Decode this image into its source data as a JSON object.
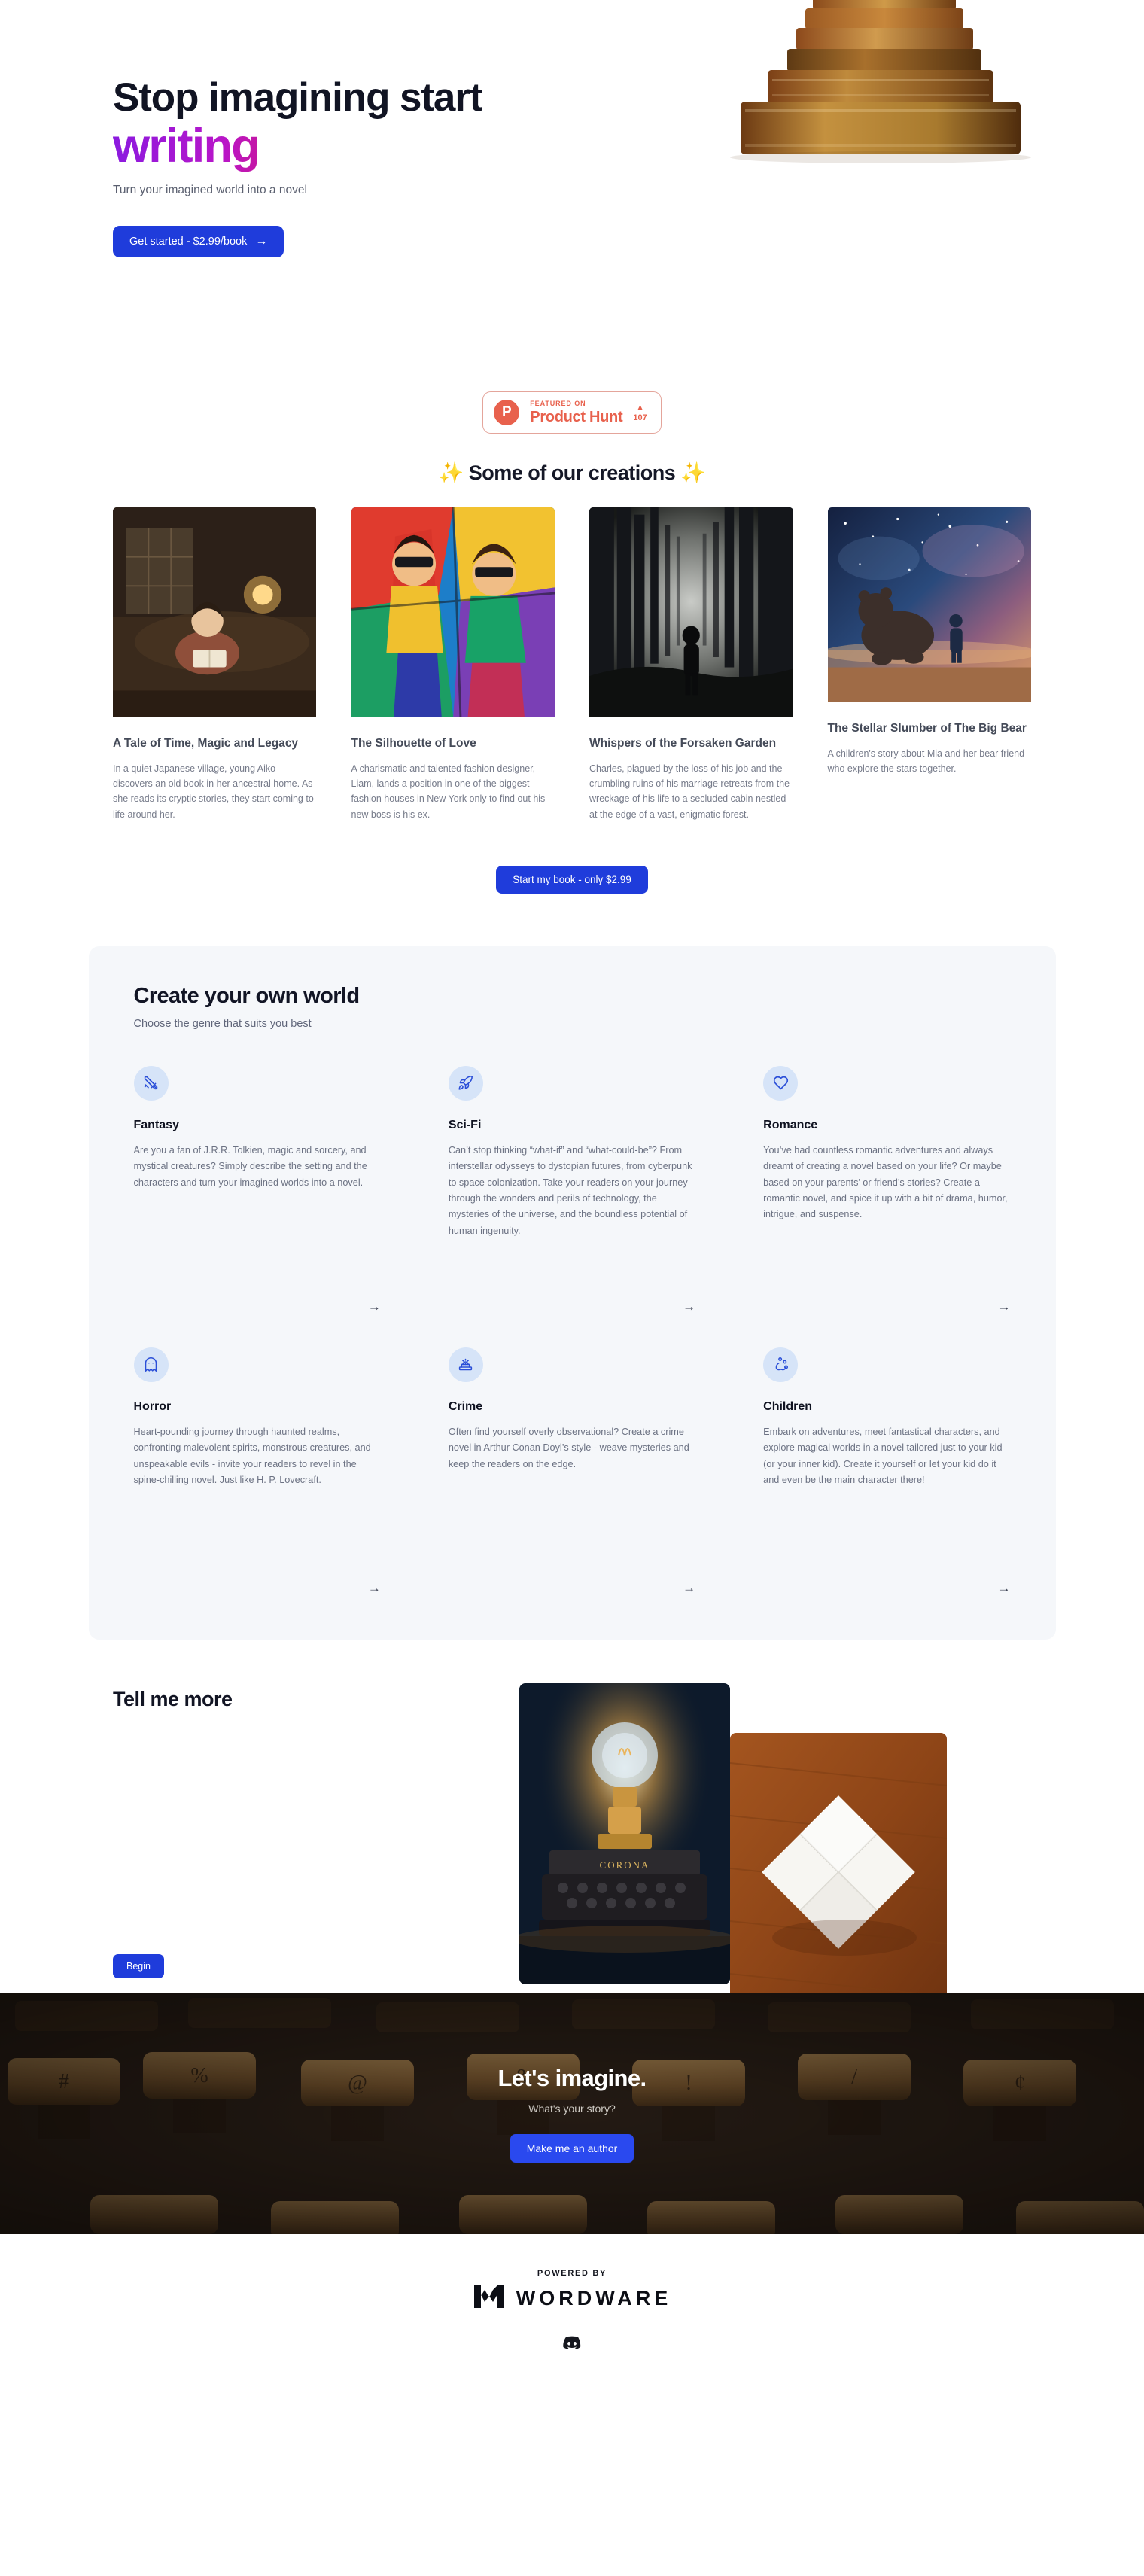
{
  "hero": {
    "title_line1": "Stop imagining start",
    "title_line2": "writing",
    "subtitle": "Turn your imagined world into a novel",
    "cta_label": "Get started - $2.99/book",
    "cta_arrow": "→",
    "books_alt": "stack-of-antique-books"
  },
  "product_hunt": {
    "logo_letter": "P",
    "kicker": "FEATURED ON",
    "name": "Product Hunt",
    "triangle": "▲",
    "votes": "107"
  },
  "creations": {
    "heading": "✨ Some of our creations ✨",
    "cta_label": "Start my book - only $2.99",
    "cards": [
      {
        "title": "A Tale of Time, Magic and Legacy",
        "desc": "In a quiet Japanese village, young Aiko discovers an old book in her ancestral home. As she reads its cryptic stories, they start coming to life around her.",
        "image_alt": "japanese-girl-reading-book-illustration"
      },
      {
        "title": "The Silhouette of Love",
        "desc": "A charismatic and talented fashion designer, Liam, lands a position in one of the biggest fashion houses in New York only to find out his new boss is his ex.",
        "image_alt": "colorful-cubist-fashion-couple-illustration"
      },
      {
        "title": "Whispers of the Forsaken Garden",
        "desc": "Charles, plagued by the loss of his job and the crumbling ruins of his marriage retreats from the wreckage of his life to a secluded cabin nestled at the edge of a vast, enigmatic forest.",
        "image_alt": "dark-forest-silhouette-figure"
      },
      {
        "title": "The Stellar Slumber of The Big Bear",
        "desc": "A children's story about Mia and her bear friend who explore the stars together.",
        "image_alt": "bear-and-child-starry-night-beach"
      }
    ]
  },
  "genres": {
    "heading": "Create your own world",
    "subheading": "Choose the genre that suits you best",
    "arrow": "→",
    "items": [
      {
        "name": "Fantasy",
        "icon": "crossed-swords-icon",
        "desc": "Are you a fan of J.R.R. Tolkien, magic and sorcery, and mystical creatures? Simply describe the setting and the characters and turn your imagined worlds into a novel.",
        "show_arrow": true
      },
      {
        "name": "Sci-Fi",
        "icon": "rocket-icon",
        "desc": "Can’t stop thinking “what-if” and “what-could-be”? From interstellar odysseys to dystopian futures, from cyberpunk to space colonization. Take your readers on your journey through the wonders and perils of technology, the mysteries of the universe, and the boundless potential of human ingenuity.",
        "show_arrow": true
      },
      {
        "name": "Romance",
        "icon": "heart-icon",
        "desc": "You’ve had countless romantic adventures and always dreamt of creating a novel based on your life? Or maybe based on your parents’ or friend’s stories? Create a romantic novel, and spice it up with a bit of drama, humor, intrigue, and suspense.",
        "show_arrow": true
      },
      {
        "name": "Horror",
        "icon": "ghost-icon",
        "desc": "Heart-pounding journey through haunted realms, confronting malevolent spirits, monstrous creatures, and unspeakable evils - invite your readers to revel in the spine-chilling novel. Just like H. P. Lovecraft.",
        "show_arrow": true
      },
      {
        "name": "Crime",
        "icon": "police-siren-icon",
        "desc": "Often find yourself overly observational? Create a crime novel in Arthur Conan Doyl’s style - weave mysteries and keep the readers on the edge.",
        "show_arrow": true
      },
      {
        "name": "Children",
        "icon": "paw-print-icon",
        "desc": "Embark on adventures, meet fantastical characters, and explore magical worlds in a novel tailored just to your kid (or your inner kid). Create it yourself or let your kid do it and even be the main character there!",
        "show_arrow": true
      }
    ]
  },
  "tell_me_more": {
    "heading": "Tell me more",
    "cta_label": "Begin",
    "image1_alt": "vintage-corona-typewriter-with-lightbulb",
    "image2_alt": "folded-white-paper-on-wooden-desk"
  },
  "final_cta": {
    "heading": "Let's imagine.",
    "subheading": "What's your story?",
    "cta_label": "Make me an author",
    "background_alt": "typewriter-keys-closeup"
  },
  "footer": {
    "powered_by": "POWERED BY",
    "brand": "WORDWARE",
    "discord_label": "discord-icon"
  },
  "colors": {
    "primary_blue": "#1f3cdb",
    "cta_blue": "#2a49ef",
    "product_hunt": "#e8614d",
    "genre_bg": "#f5f7fa",
    "icon_bg": "#d6e4f8",
    "icon_stroke": "#2b4fd8"
  }
}
